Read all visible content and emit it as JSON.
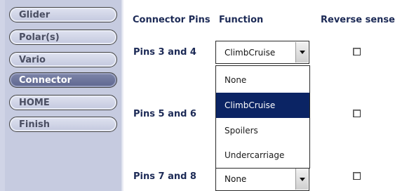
{
  "sidebar": {
    "items": [
      {
        "label": "Glider",
        "active": false
      },
      {
        "label": "Polar(s)",
        "active": false
      },
      {
        "label": "Vario",
        "active": false
      },
      {
        "label": "Connector",
        "active": true
      },
      {
        "label": "HOME",
        "active": false
      },
      {
        "label": "Finish",
        "active": false
      }
    ]
  },
  "table": {
    "headers": {
      "pins": "Connector Pins",
      "function": "Function",
      "reverse": "Reverse sense?"
    },
    "rows": [
      {
        "pins": "Pins 3 and 4",
        "function": "ClimbCruise",
        "reverse": false
      },
      {
        "pins": "Pins 5 and 6",
        "function": "",
        "reverse": false
      },
      {
        "pins": "Pins 7 and 8",
        "function": "None",
        "reverse": false
      }
    ]
  },
  "dropdown": {
    "open": true,
    "options": [
      "None",
      "ClimbCruise",
      "Spoilers",
      "Undercarriage"
    ],
    "selected": "ClimbCruise"
  },
  "colors": {
    "sidebar_bg": "#c6cbe0",
    "active_button": "#6a729a",
    "header_text": "#1c2a56",
    "selected_option": "#0b2464"
  },
  "icons": {
    "dropdown_arrow": "chevron-down-icon"
  }
}
